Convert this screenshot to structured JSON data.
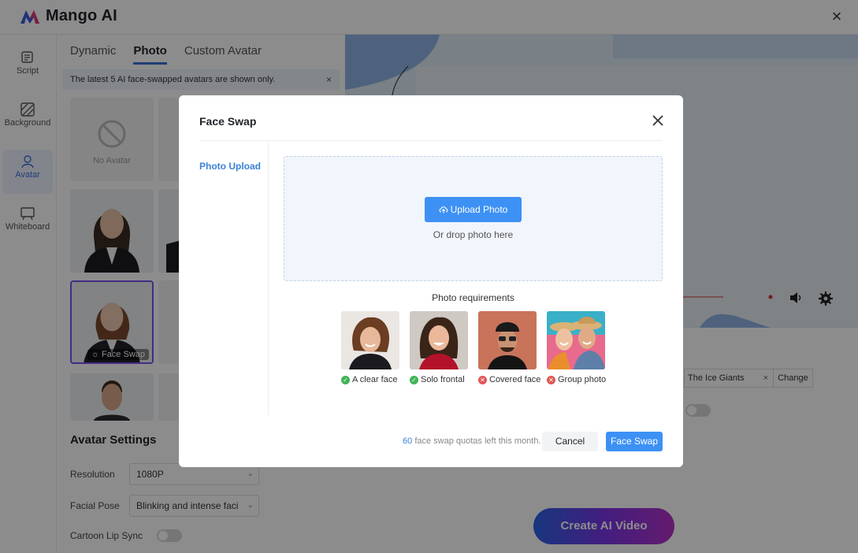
{
  "app": {
    "name": "Mango AI",
    "brand_color": "#3b6fd8"
  },
  "leftnav": {
    "items": [
      {
        "label": "Script",
        "icon": "script-icon"
      },
      {
        "label": "Background",
        "icon": "background-icon"
      },
      {
        "label": "Avatar",
        "icon": "avatar-icon",
        "active": true
      },
      {
        "label": "Whiteboard",
        "icon": "whiteboard-icon"
      }
    ]
  },
  "panel": {
    "tabs": [
      {
        "label": "Dynamic"
      },
      {
        "label": "Photo",
        "active": true
      },
      {
        "label": "Custom Avatar"
      }
    ],
    "notice": "The latest 5 AI face-swapped avatars are shown only.",
    "no_avatar_label": "No Avatar",
    "face_swap_badge": "Face Swap",
    "settings": {
      "title": "Avatar Settings",
      "resolution_label": "Resolution",
      "resolution_value": "1080P",
      "facial_pose_label": "Facial Pose",
      "facial_pose_value": "Blinking and intense faci",
      "cartoon_lip_sync_label": "Cartoon Lip Sync"
    }
  },
  "right": {
    "background_name": "The Ice Giants",
    "change_label": "Change",
    "create_button": "Create AI Video"
  },
  "modal": {
    "title": "Face Swap",
    "side_tab": "Photo Upload",
    "upload_button": "Upload Photo",
    "drop_hint": "Or drop photo here",
    "requirements_title": "Photo requirements",
    "requirements": [
      {
        "label": "A clear face",
        "ok": true
      },
      {
        "label": "Solo frontal",
        "ok": true
      },
      {
        "label": "Covered face",
        "ok": false
      },
      {
        "label": "Group photo",
        "ok": false
      }
    ],
    "quota_count": "60",
    "quota_text": "face swap quotas left this month.",
    "cancel_button": "Cancel",
    "face_swap_button": "Face Swap"
  }
}
